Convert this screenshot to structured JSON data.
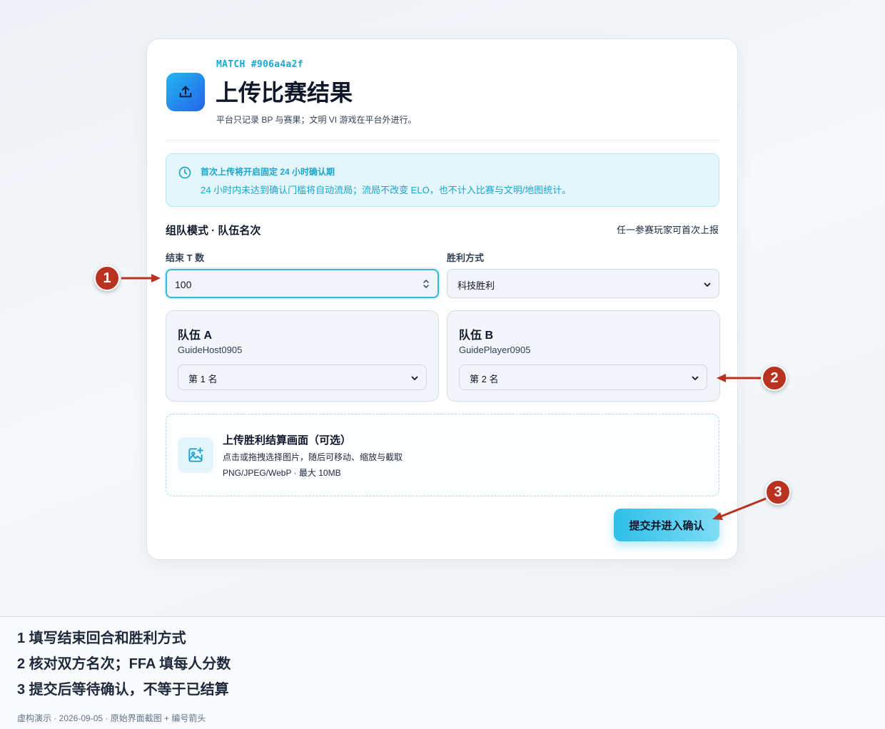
{
  "header": {
    "match_id": "MATCH #906a4a2f",
    "title": "上传比赛结果",
    "subtitle": "平台只记录 BP 与赛果；文明 VI 游戏在平台外进行。"
  },
  "notice": {
    "title": "首次上传将开启固定 24 小时确认期",
    "text": "24 小时内未达到确认门槛将自动流局；流局不改变 ELO，也不计入比赛与文明/地图统计。"
  },
  "section": {
    "title": "组队模式 · 队伍名次",
    "note": "任一参赛玩家可首次上报"
  },
  "fields": {
    "end_turn_label": "结束 T 数",
    "end_turn_value": "100",
    "victory_label": "胜利方式",
    "victory_value": "科技胜利"
  },
  "teams": [
    {
      "name": "队伍 A",
      "player": "GuideHost0905",
      "rank": "第 1 名"
    },
    {
      "name": "队伍 B",
      "player": "GuidePlayer0905",
      "rank": "第 2 名"
    }
  ],
  "upload": {
    "title": "上传胜利结算画面（可选）",
    "hint": "点击或拖拽选择图片，随后可移动、缩放与截取",
    "formats": "PNG/JPEG/WebP · 最大 10MB"
  },
  "submit_label": "提交并进入确认",
  "badges": [
    "1",
    "2",
    "3"
  ],
  "steps": [
    "1 填写结束回合和胜利方式",
    "2 核对双方名次；FFA 填每人分数",
    "3 提交后等待确认，不等于已结算"
  ],
  "footer": "虚构演示 · 2026-09-05 · 原始界面截图 + 编号箭头",
  "colors": {
    "accent": "#17a9d6",
    "notice_bg": "#e3f6fc",
    "badge": "#b8321f",
    "submit_start": "#2cc0e8",
    "submit_end": "#7fdcf5"
  },
  "icons": {
    "app": "upload-icon",
    "notice": "clock-icon",
    "upload": "image-plus-icon"
  }
}
